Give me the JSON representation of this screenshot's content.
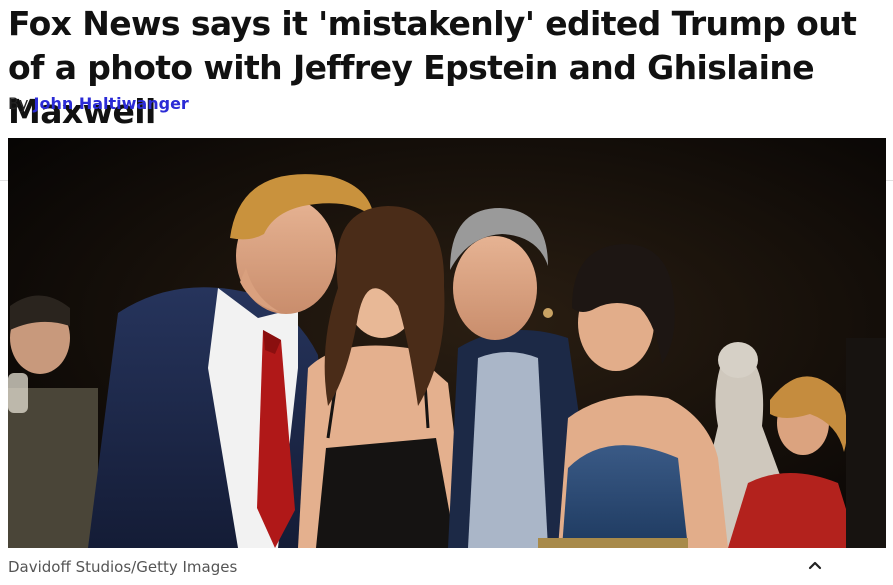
{
  "article": {
    "headline": "Fox News says it 'mistakenly' edited Trump out of a photo with Jeffrey Epstein and Ghislaine Maxwell",
    "byline_prefix": "By",
    "author": "John Haltiwanger"
  },
  "photo": {
    "caption": "Davidoff Studios/Getty Images"
  },
  "controls": {
    "collapse_icon": "chevron-up-icon"
  },
  "colors": {
    "author_link": "#2b2bd6",
    "headline_text": "#111111",
    "caption_text": "#555555"
  }
}
